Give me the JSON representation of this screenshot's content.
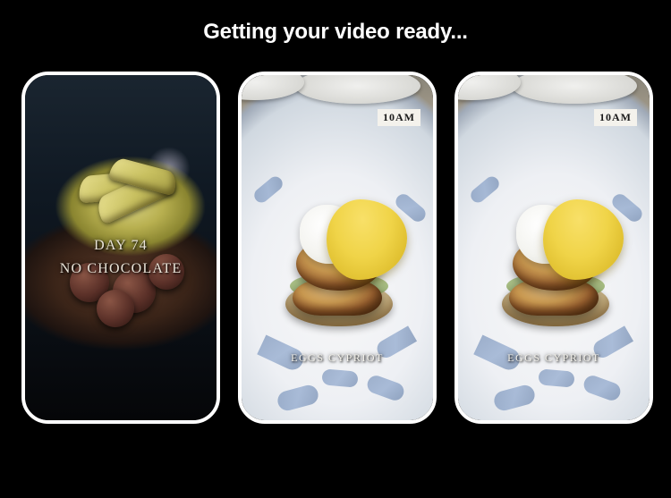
{
  "header": {
    "title": "Getting your video ready..."
  },
  "clips": [
    {
      "overlay_line1": "DAY 74",
      "overlay_line2": "NO CHOCOLATE"
    },
    {
      "time_label": "10AM",
      "dish_label": "EGGS CYPRIOT"
    },
    {
      "time_label": "10AM",
      "dish_label": "EGGS CYPRIOT"
    }
  ]
}
